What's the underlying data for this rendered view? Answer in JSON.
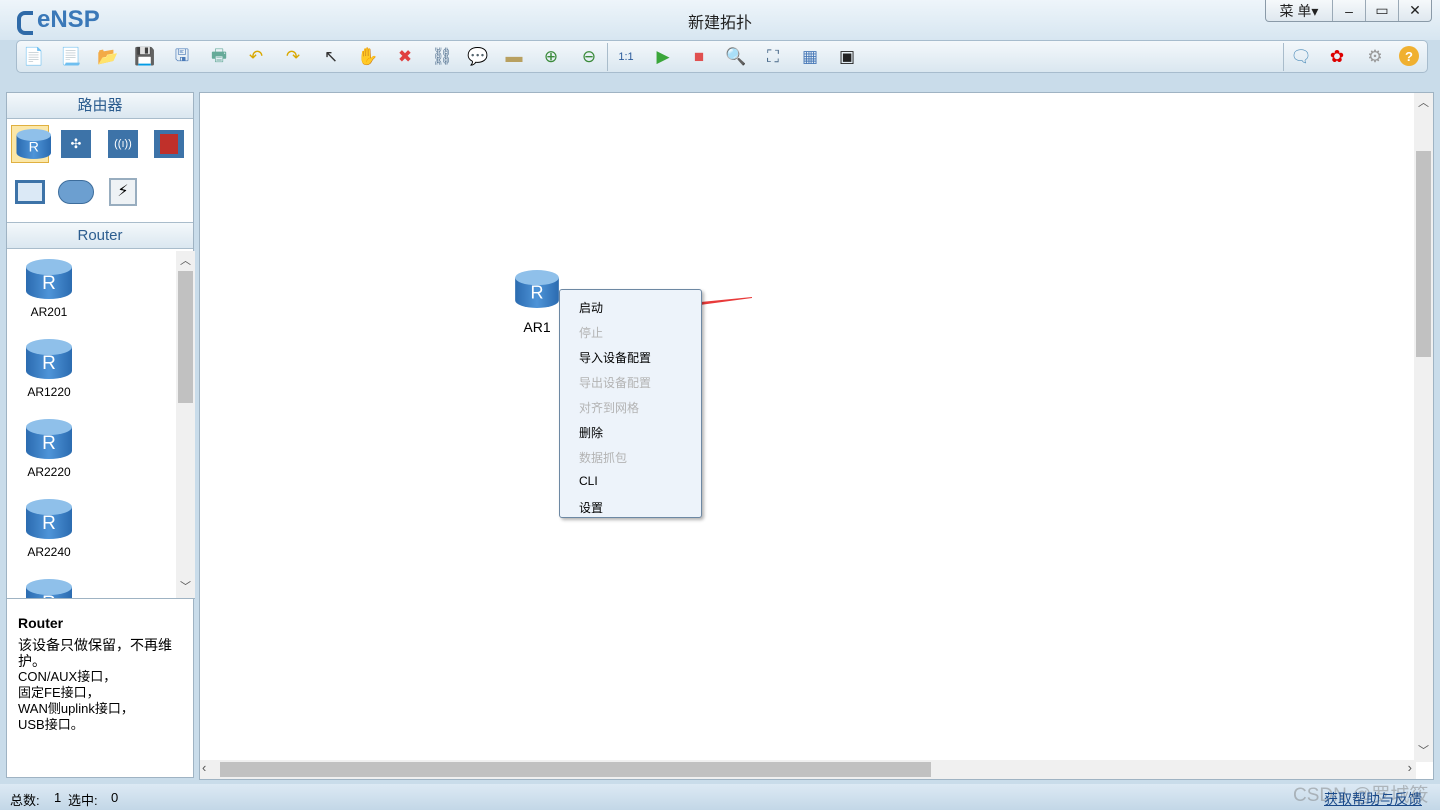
{
  "window": {
    "app_name": "eNSP",
    "title": "新建拓扑",
    "menu_label": "菜 单▾",
    "minimize": "‒",
    "maximize": "▭",
    "close": "✕"
  },
  "toolbar": {
    "left": [
      {
        "name": "new-topology-icon",
        "glyph": "📄",
        "color": "#6a8"
      },
      {
        "name": "new-lab-icon",
        "glyph": "📃",
        "color": "#6a8"
      },
      {
        "name": "open-icon",
        "glyph": "📂",
        "color": "#d9b45a"
      },
      {
        "name": "save-icon",
        "glyph": "💾",
        "color": "#4a7ab8"
      },
      {
        "name": "save-as-icon",
        "glyph": "🖫",
        "color": "#4a7ab8"
      },
      {
        "name": "print-icon",
        "glyph": "🖶",
        "color": "#6a9"
      },
      {
        "name": "undo-icon",
        "glyph": "↶",
        "color": "#d9a800"
      },
      {
        "name": "redo-icon",
        "glyph": "↷",
        "color": "#d9a800"
      },
      {
        "name": "select-icon",
        "glyph": "↖",
        "color": "#333"
      },
      {
        "name": "hand-icon",
        "glyph": "✋",
        "color": "#e2b27a"
      },
      {
        "name": "delete-icon",
        "glyph": "✖",
        "color": "#e04040"
      },
      {
        "name": "delete-link-icon",
        "glyph": "⛓",
        "color": "#4a6a8a"
      },
      {
        "name": "text-icon",
        "glyph": "💬",
        "color": "#4a8ab8"
      },
      {
        "name": "palette-icon",
        "glyph": "▬",
        "color": "#b8a060"
      },
      {
        "name": "zoom-in-icon",
        "glyph": "⊕",
        "color": "#3a8a3a"
      },
      {
        "name": "zoom-out-icon",
        "glyph": "⊖",
        "color": "#3a8a3a"
      },
      {
        "name": "fit-icon",
        "glyph": "1:1",
        "color": "#2a5a9a"
      },
      {
        "name": "start-icon",
        "glyph": "▶",
        "color": "#3aa63a"
      },
      {
        "name": "stop-icon",
        "glyph": "■",
        "color": "#e05050"
      },
      {
        "name": "capture-icon",
        "glyph": "🔍",
        "color": "#4a7ab8"
      },
      {
        "name": "topology-icon",
        "glyph": "⛶",
        "color": "#4a6a8a"
      },
      {
        "name": "grid-icon",
        "glyph": "▦",
        "color": "#4a7ab8"
      },
      {
        "name": "screenshot-icon",
        "glyph": "▣",
        "color": "#222"
      }
    ],
    "right": [
      {
        "name": "forum-icon",
        "glyph": "🗨",
        "color": "#4a8ab8"
      },
      {
        "name": "huawei-icon",
        "glyph": "✿",
        "color": "#d00"
      },
      {
        "name": "settings-icon",
        "glyph": "⚙",
        "color": "#999"
      },
      {
        "name": "help-icon",
        "glyph": "?",
        "color": "#e0a020"
      }
    ]
  },
  "left_panel": {
    "category_title": "路由器",
    "categories": [
      "router-icon",
      "switch-icon",
      "wlan-icon",
      "firewall-icon",
      "pc-icon",
      "cloud-icon",
      "other-device-icon"
    ],
    "device_title": "Router",
    "devices": [
      {
        "label": "AR201"
      },
      {
        "label": "AR1220"
      },
      {
        "label": "AR2220"
      },
      {
        "label": "AR2240"
      }
    ],
    "description": {
      "title": "Router",
      "lines": [
        "该设备只做保留，不再维护。",
        "CON/AUX接口，",
        "固定FE接口，",
        "WAN侧uplink接口，",
        "USB接口。"
      ]
    }
  },
  "canvas": {
    "node": {
      "label": "AR1"
    },
    "context_menu": [
      {
        "label": "启动",
        "enabled": true
      },
      {
        "label": "停止",
        "enabled": false
      },
      {
        "label": "导入设备配置",
        "enabled": true
      },
      {
        "label": "导出设备配置",
        "enabled": false
      },
      {
        "label": "对齐到网格",
        "enabled": false
      },
      {
        "label": "删除",
        "enabled": true
      },
      {
        "label": "数据抓包",
        "enabled": false
      },
      {
        "label": "CLI",
        "enabled": true
      },
      {
        "label": "设置",
        "enabled": true
      }
    ],
    "annotation_color": "#e83a3a"
  },
  "status": {
    "total_label": "总数:",
    "total": "1",
    "selected_label": "选中:",
    "selected": "0",
    "help_link": "获取帮助与反馈",
    "watermark": "CSDN @罗城筱"
  }
}
